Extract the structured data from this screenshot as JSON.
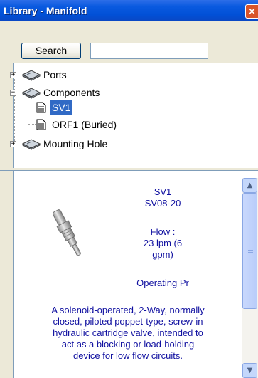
{
  "window": {
    "title": "Library - Manifold",
    "close_glyph": "×"
  },
  "search": {
    "button_label": "Search",
    "value": ""
  },
  "tree": {
    "nodes": [
      {
        "label": "Ports",
        "expander": "+"
      },
      {
        "label": "Components",
        "expander": "−"
      },
      {
        "label": "SV1"
      },
      {
        "label": "ORF1 (Buried)"
      },
      {
        "label": "Mounting Hole",
        "expander": "+"
      }
    ]
  },
  "details": {
    "name": "SV1",
    "model": "SV08-20",
    "flow_label": "Flow :",
    "flow_value_line1": "23 lpm (6",
    "flow_value_line2": "gpm)",
    "operating_partial": "Operating Pr",
    "description_lines": [
      "A solenoid-operated, 2-Way, normally",
      "closed, piloted poppet-type, screw-in",
      "hydraulic cartridge valve, intended to",
      "act as a blocking or load-holding",
      "device for low flow circuits."
    ]
  },
  "colors": {
    "title_bar": "#0a5ae0",
    "selection": "#316ac5",
    "detail_text": "#1010a0",
    "close_button": "#d9542a"
  },
  "icons": {
    "node": "book-icon",
    "leaf": "document-icon",
    "product": "valve-image"
  }
}
